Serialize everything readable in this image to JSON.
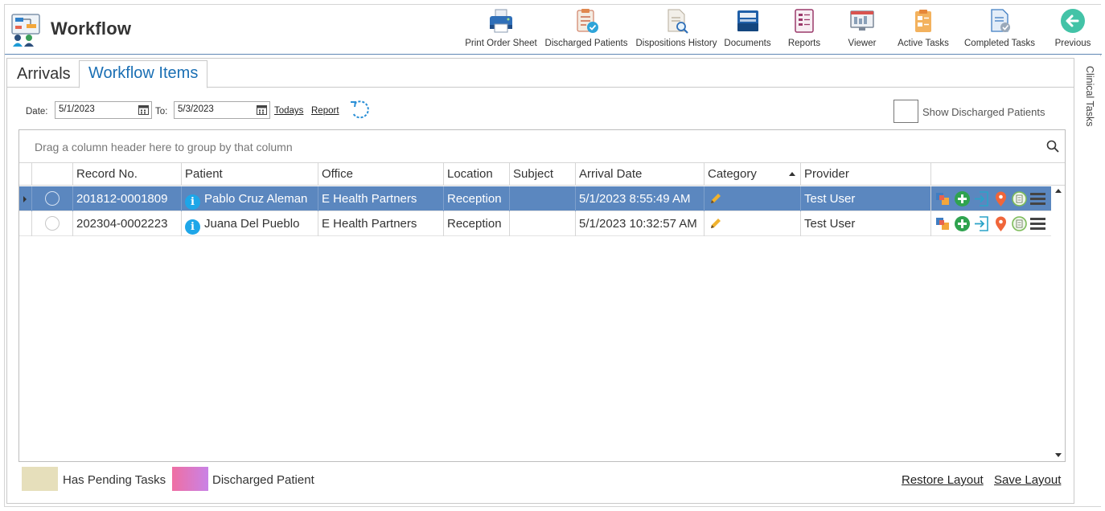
{
  "app": {
    "title": "Workflow"
  },
  "toolbar": {
    "print_order_sheet": "Print Order Sheet",
    "discharged_patients": "Discharged Patients",
    "dispositions_history": "Dispositions History",
    "documents": "Documents",
    "reports": "Reports",
    "viewer": "Viewer",
    "active_tasks": "Active Tasks",
    "completed_tasks": "Completed Tasks",
    "previous": "Previous"
  },
  "side_rail": {
    "label": "Clinical Tasks"
  },
  "tabs": [
    {
      "label": "Arrivals",
      "active": false
    },
    {
      "label": "Workflow Items",
      "active": true
    }
  ],
  "filters": {
    "date_label": "Date:",
    "date_from": "5/1/2023",
    "to_label": "To:",
    "date_to": "5/3/2023",
    "todays_link": "Todays",
    "report_link": "Report",
    "show_discharged_label": "Show Discharged Patients",
    "show_discharged_checked": false
  },
  "grid": {
    "group_hint": "Drag a column header here to group by that column",
    "columns": [
      "Record No.",
      "Patient",
      "Office",
      "Location",
      "Subject",
      "Arrival Date",
      "Category",
      "Provider"
    ],
    "sorted_column": "Category",
    "sort_direction": "ascending",
    "rows": [
      {
        "record_no": "201812-0001809",
        "patient": "Pablo Cruz Aleman",
        "office": "E Health Partners",
        "location": "Reception",
        "subject": "",
        "arrival_date": "5/1/2023 8:55:49 AM",
        "provider": "Test User",
        "selected": true
      },
      {
        "record_no": "202304-0002223",
        "patient": "Juana Del Pueblo",
        "office": "E Health Partners",
        "location": "Reception",
        "subject": "",
        "arrival_date": "5/1/2023 10:32:57 AM",
        "provider": "Test User",
        "selected": false
      }
    ]
  },
  "legend": [
    {
      "label": "Has Pending Tasks",
      "color": "#e6dfbb"
    },
    {
      "label": "Discharged Patient",
      "color_from": "#ef6fa3",
      "color_to": "#c982e6"
    }
  ],
  "footer": {
    "restore_layout": "Restore Layout",
    "save_layout": "Save Layout"
  },
  "colors": {
    "accent": "#1a6fb4",
    "selected_row": "#5b87bf",
    "toolbar_rule": "#5f87b4"
  }
}
